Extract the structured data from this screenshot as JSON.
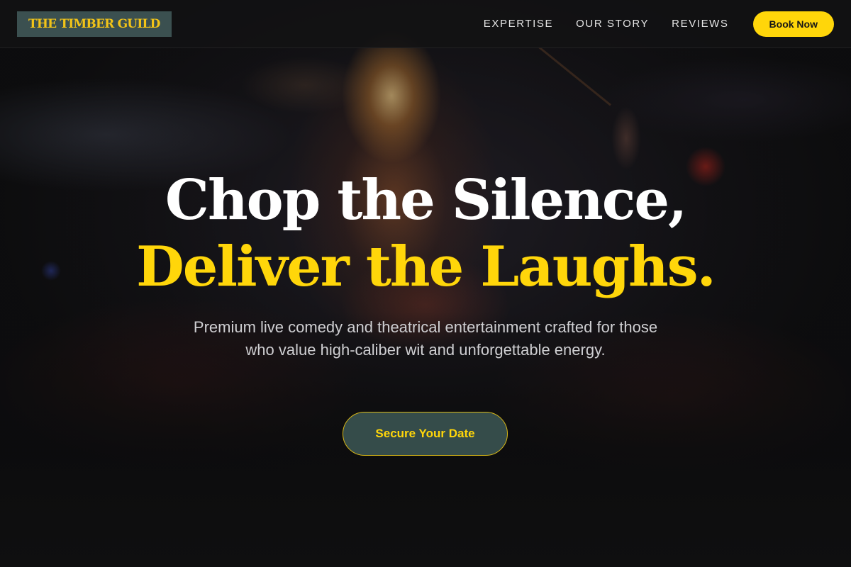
{
  "nav": {
    "logo_text": "THE TIMBER GUILD",
    "links": [
      "EXPERTISE",
      "OUR STORY",
      "REVIEWS"
    ],
    "cta_label": "Book Now"
  },
  "hero": {
    "headline_line_1": "Chop the Silence,",
    "headline_line_2": "Deliver the Laughs.",
    "subtext": "Premium live comedy and theatrical entertainment crafted for those who value high-caliber wit and unforgettable energy.",
    "cta_label": "Secure Your Date"
  },
  "colors": {
    "accent_yellow": "#ffd60a",
    "logo_background": "#3b5050",
    "cta_background": "#354c4a",
    "page_background": "#0f0f10"
  }
}
